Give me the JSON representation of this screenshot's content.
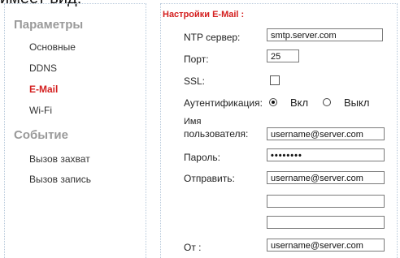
{
  "top_clip_text": "имеет вид:",
  "sidebar": {
    "params_title": "Параметры",
    "params_items": [
      {
        "label": "Основные",
        "active": false
      },
      {
        "label": "DDNS",
        "active": false
      },
      {
        "label": "E-Mail",
        "active": true
      },
      {
        "label": "Wi-Fi",
        "active": false
      }
    ],
    "event_title": "Событие",
    "event_items": [
      {
        "label": "Вызов захват"
      },
      {
        "label": "Вызов запись"
      }
    ]
  },
  "form": {
    "title": "Настройки E-Mail :",
    "ntp_label": "NTP сервер:",
    "ntp_value": "smtp.server.com",
    "port_label": "Порт:",
    "port_value": "25",
    "ssl_label": "SSL:",
    "ssl_checked": false,
    "auth_label": "Аутентификация:",
    "auth_on_label": "Вкл",
    "auth_off_label": "Выкл",
    "auth_selected": "Вкл",
    "username_label_line1": "Имя",
    "username_label_line2": "пользователя:",
    "username_value": "username@server.com",
    "password_label": "Пароль:",
    "password_value": "••••••••",
    "send_label": "Отправить:",
    "send_values": [
      "username@server.com",
      "",
      ""
    ],
    "from_label": "От :",
    "from_value": "username@server.com"
  },
  "colors": {
    "accent": "#d42020",
    "section_gray": "#9a9a9a",
    "dotted_border": "#b6c8da"
  }
}
